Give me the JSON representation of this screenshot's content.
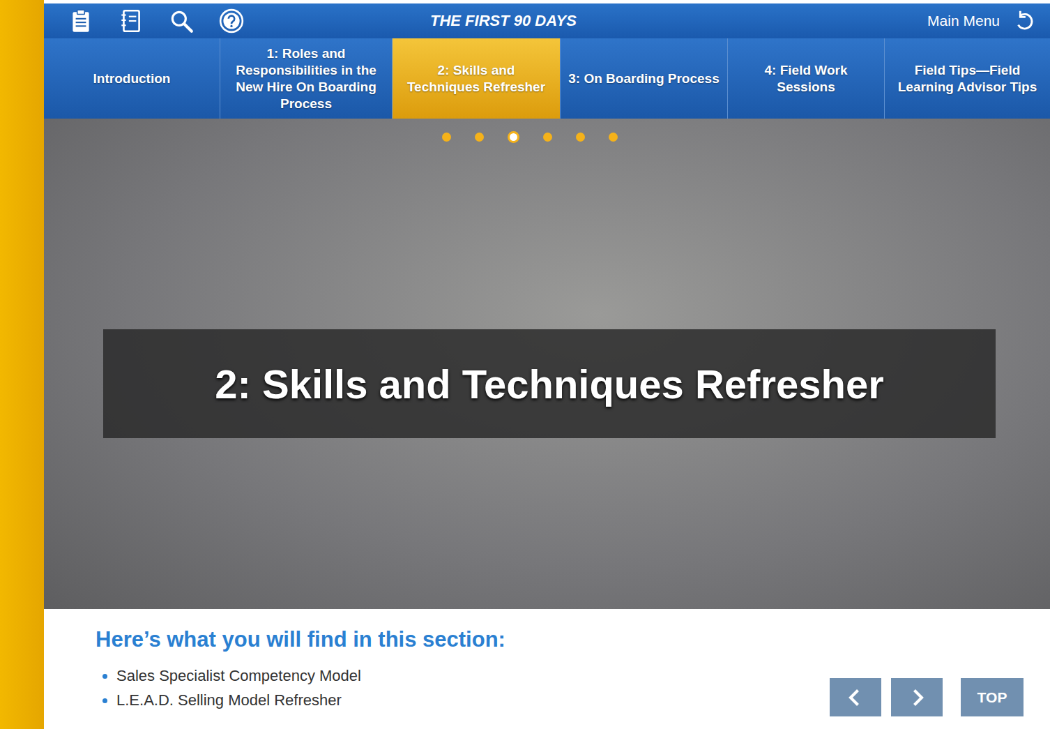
{
  "header": {
    "title": "THE FIRST 90 DAYS",
    "main_menu": "Main Menu"
  },
  "tabs": [
    {
      "label": "Introduction",
      "selected": false
    },
    {
      "label": "1: Roles and Responsibilities in the New Hire On Boarding Process",
      "selected": false
    },
    {
      "label": "2: Skills and Techniques Refresher",
      "selected": true
    },
    {
      "label": "3: On Boarding Process",
      "selected": false
    },
    {
      "label": "4: Field Work Sessions",
      "selected": false
    },
    {
      "label": "Field Tips—Field Learning Advisor Tips",
      "selected": false
    }
  ],
  "slides": [
    {
      "selected": false
    },
    {
      "selected": false
    },
    {
      "selected": true
    },
    {
      "selected": false
    },
    {
      "selected": false
    },
    {
      "selected": false
    }
  ],
  "hero": {
    "title": "2: Skills and Techniques Refresher"
  },
  "section": {
    "heading": "Here’s what you will find in this section:",
    "items": [
      "Sales Specialist Competency Model",
      "L.E.A.D. Selling Model Refresher"
    ]
  },
  "buttons": {
    "top": "TOP"
  }
}
